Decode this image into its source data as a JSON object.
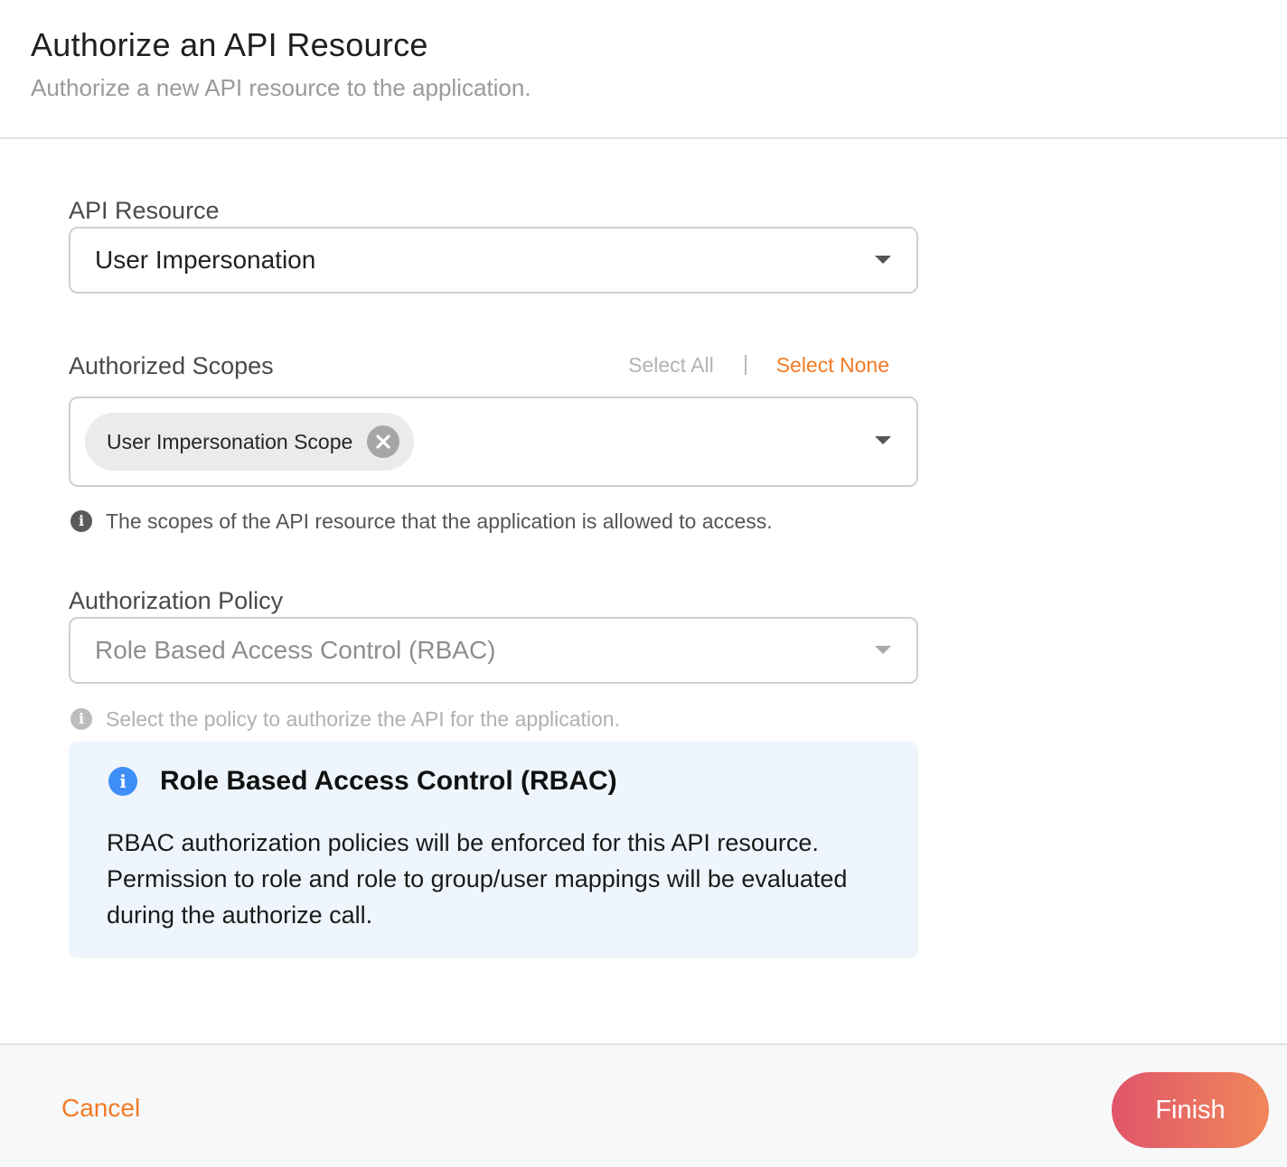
{
  "header": {
    "title": "Authorize an API Resource",
    "subtitle": "Authorize a new API resource to the application."
  },
  "api_resource": {
    "label": "API Resource",
    "value": "User Impersonation",
    "icon": "chevron-down-icon"
  },
  "scopes": {
    "label": "Authorized Scopes",
    "select_all_label": "Select All",
    "select_none_label": "Select None",
    "chips": [
      {
        "label": "User Impersonation Scope"
      }
    ],
    "hint": "The scopes of the API resource that the application is allowed to access."
  },
  "policy": {
    "label": "Authorization Policy",
    "value": "Role Based Access Control (RBAC)",
    "hint": "Select the policy to authorize the API for the application."
  },
  "info": {
    "title": "Role Based Access Control (RBAC)",
    "body": "RBAC authorization policies will be enforced for this API resource. Permission to role and role to group/user mappings will be evaluated during the authorize call."
  },
  "footer": {
    "cancel_label": "Cancel",
    "finish_label": "Finish"
  },
  "colors": {
    "accent": "#f47b25",
    "info_icon": "#3e8ef7",
    "info_bg": "#eef5fc",
    "finish_gradient_start": "#e0556a",
    "finish_gradient_end": "#f0875a"
  }
}
